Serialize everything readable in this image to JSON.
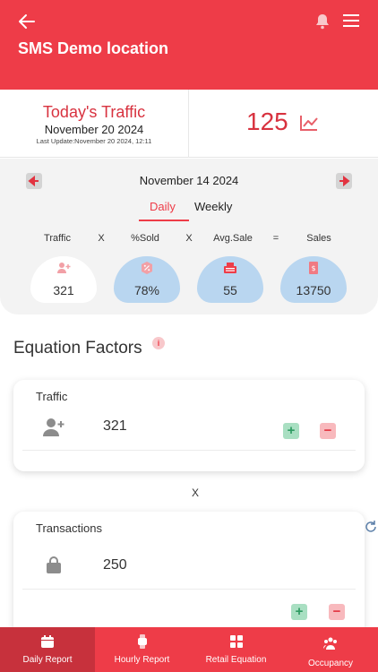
{
  "header": {
    "title": "SMS Demo location"
  },
  "traffic": {
    "title": "Today's Traffic",
    "date": "November 20 2024",
    "last_update": "Last Update:November 20 2024, 12:11",
    "value": "125"
  },
  "date_panel": {
    "date": "November 14 2024",
    "tabs": [
      "Daily",
      "Weekly"
    ],
    "equation_labels": [
      "Traffic",
      "X",
      "%Sold",
      "X",
      "Avg.Sale",
      "=",
      "Sales"
    ],
    "cards": [
      {
        "icon": "add-user-icon",
        "value": "321"
      },
      {
        "icon": "percent-badge-icon",
        "value": "78%"
      },
      {
        "icon": "register-icon",
        "value": "55"
      },
      {
        "icon": "money-icon",
        "value": "13750"
      }
    ]
  },
  "factors": {
    "title": "Equation Factors",
    "items": [
      {
        "name": "Traffic",
        "value": "321",
        "icon": "add-user-icon"
      },
      {
        "name": "Transactions",
        "value": "250",
        "icon": "shopping-bag-icon"
      }
    ],
    "times": "X"
  },
  "nav": {
    "items": [
      {
        "label": "Daily Report",
        "icon": "calendar-icon"
      },
      {
        "label": "Hourly Report",
        "icon": "watch-icon"
      },
      {
        "label": "Retail Equation",
        "icon": "calculator-icon"
      },
      {
        "label": "Occupancy",
        "icon": "users-icon"
      }
    ]
  },
  "colors": {
    "primary": "#ee3c48",
    "card_blue": "#b9d6f0",
    "plus": "#a9dfc2",
    "minus": "#f8b9bd"
  }
}
